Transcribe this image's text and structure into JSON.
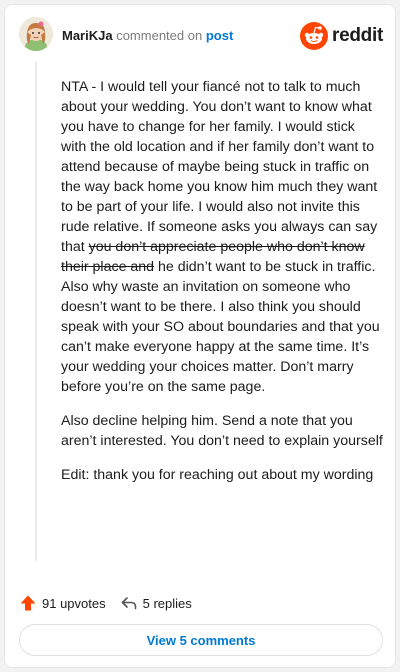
{
  "header": {
    "username": "MariKJa",
    "action": "commented on",
    "target_link": "post",
    "brand": "reddit"
  },
  "comment": {
    "p1": {
      "before_strike": "NTA - I would tell your fiancé not to talk to much about your wedding. You don’t want to know what you have to change for her family. I would stick with the old location and if her family don’t want to attend because of maybe being stuck in traffic on the way back home you know him much they want to be part of your life. I would also not invite this rude relative. If someone asks you always can say that ",
      "strike": "you don’t appreciate people who don’t know their place and",
      "after_strike": " he didn’t want to be stuck in traffic. Also why waste an invitation on someone who doesn’t want to be there. I also think you should speak with your SO about boundaries and that you can’t make everyone happy at the same time. It’s your wedding your choices matter. Don’t marry before you’re on the same page."
    },
    "p2": "Also decline helping him. Send a note that you aren’t interested. You don’t need to explain yourself",
    "p3": "Edit: thank you for reaching out about my wording"
  },
  "actions": {
    "upvotes": "91 upvotes",
    "replies": "5 replies"
  },
  "view_comments": "View 5 comments",
  "colors": {
    "brand_orange": "#ff4500",
    "link_blue": "#0079d3",
    "upvote_arrow": "#ff4500"
  },
  "icons": {
    "brand": "reddit-snoo-icon",
    "upvote": "upvote-arrow-icon",
    "reply": "reply-arrow-icon"
  }
}
